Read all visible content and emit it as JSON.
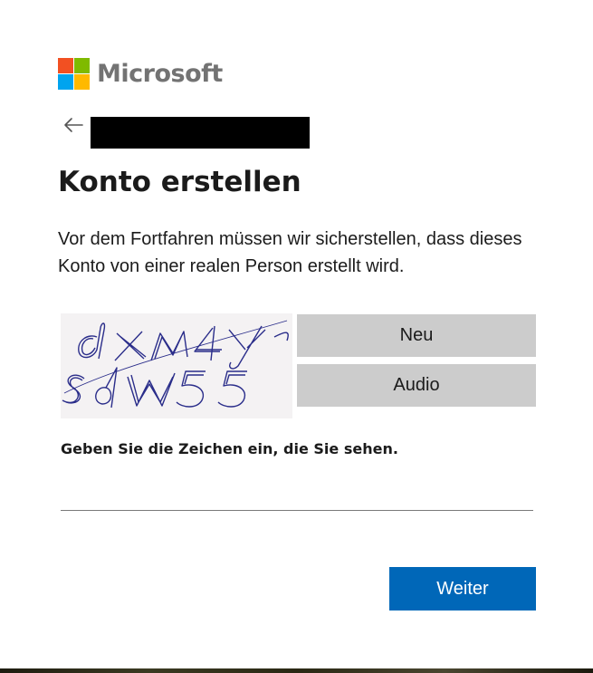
{
  "brand": {
    "name": "Microsoft",
    "logo_colors": [
      "#f25022",
      "#7fba00",
      "#00a4ef",
      "#ffb900"
    ]
  },
  "header": {
    "back_icon": "arrow-left-icon",
    "account_identifier": ""
  },
  "page": {
    "title": "Konto erstellen",
    "description": "Vor dem Fortfahren müssen wir sicherstellen, dass dieses Konto von einer realen Person erstellt wird."
  },
  "captcha": {
    "image_text": "dXM4YSdW55",
    "new_label": "Neu",
    "audio_label": "Audio",
    "instruction": "Geben Sie die Zeichen ein, die Sie sehen.",
    "input_value": "",
    "input_placeholder": ""
  },
  "actions": {
    "next_label": "Weiter"
  },
  "colors": {
    "primary": "#0067b8",
    "secondary_button": "#cccccc",
    "text": "#1b1b1b"
  }
}
